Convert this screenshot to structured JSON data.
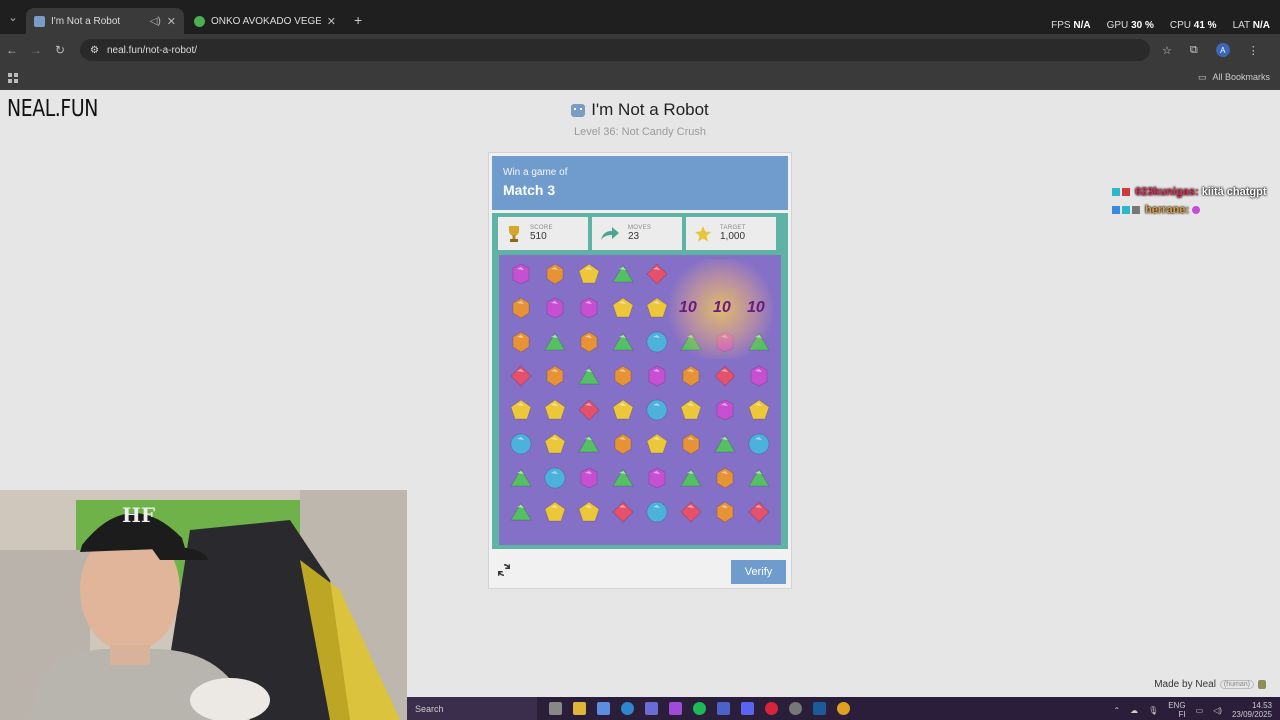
{
  "browser": {
    "tabs": [
      {
        "title": "I'm Not a Robot",
        "active": true
      },
      {
        "title": "ONKO AVOKADO VEGETABLE -",
        "active": false
      }
    ],
    "url": "neal.fun/not-a-robot/",
    "all_bookmarks": "All Bookmarks",
    "perf": {
      "fps_label": "FPS",
      "fps": "N/A",
      "gpu_label": "GPU",
      "gpu": "30 %",
      "cpu_label": "CPU",
      "cpu": "41 %",
      "lat_label": "LAT",
      "lat": "N/A"
    }
  },
  "site": {
    "logo": "NEAL.FUN",
    "title": "I'm Not a Robot",
    "subtitle": "Level 36: Not Candy Crush",
    "made_by": "Made by Neal",
    "made_by_tag": "(human)"
  },
  "captcha": {
    "lead": "Win a game of",
    "title": "Match 3",
    "stats": [
      {
        "label": "SCORE",
        "value": "510",
        "icon": "trophy-icon"
      },
      {
        "label": "MOVES",
        "value": "23",
        "icon": "arrow-icon"
      },
      {
        "label": "TARGET",
        "value": "1,000",
        "icon": "star-icon"
      }
    ],
    "popups": [
      "10",
      "10",
      "10"
    ],
    "board": [
      "POYGR...",
      "OPPYY...",
      "OGOGBGPG",
      "ROGOPORP",
      "YYRYBYPY",
      "BYGOYOGB",
      "GBPGPGOG",
      "GYYRBROR"
    ],
    "verify_label": "Verify"
  },
  "gem_colors": {
    "P": "#c64fd2",
    "O": "#e69235",
    "Y": "#edc73a",
    "G": "#55c063",
    "R": "#e5506a",
    "B": "#4cb2dc"
  },
  "chat": [
    {
      "user": "023kunigas:",
      "text": "kiitä chatgpt"
    },
    {
      "user": "herrane:",
      "text": ""
    }
  ],
  "taskbar": {
    "search": "Search",
    "lang": "ENG",
    "region": "FI",
    "time": "14.53",
    "date": "23/09/2025"
  }
}
